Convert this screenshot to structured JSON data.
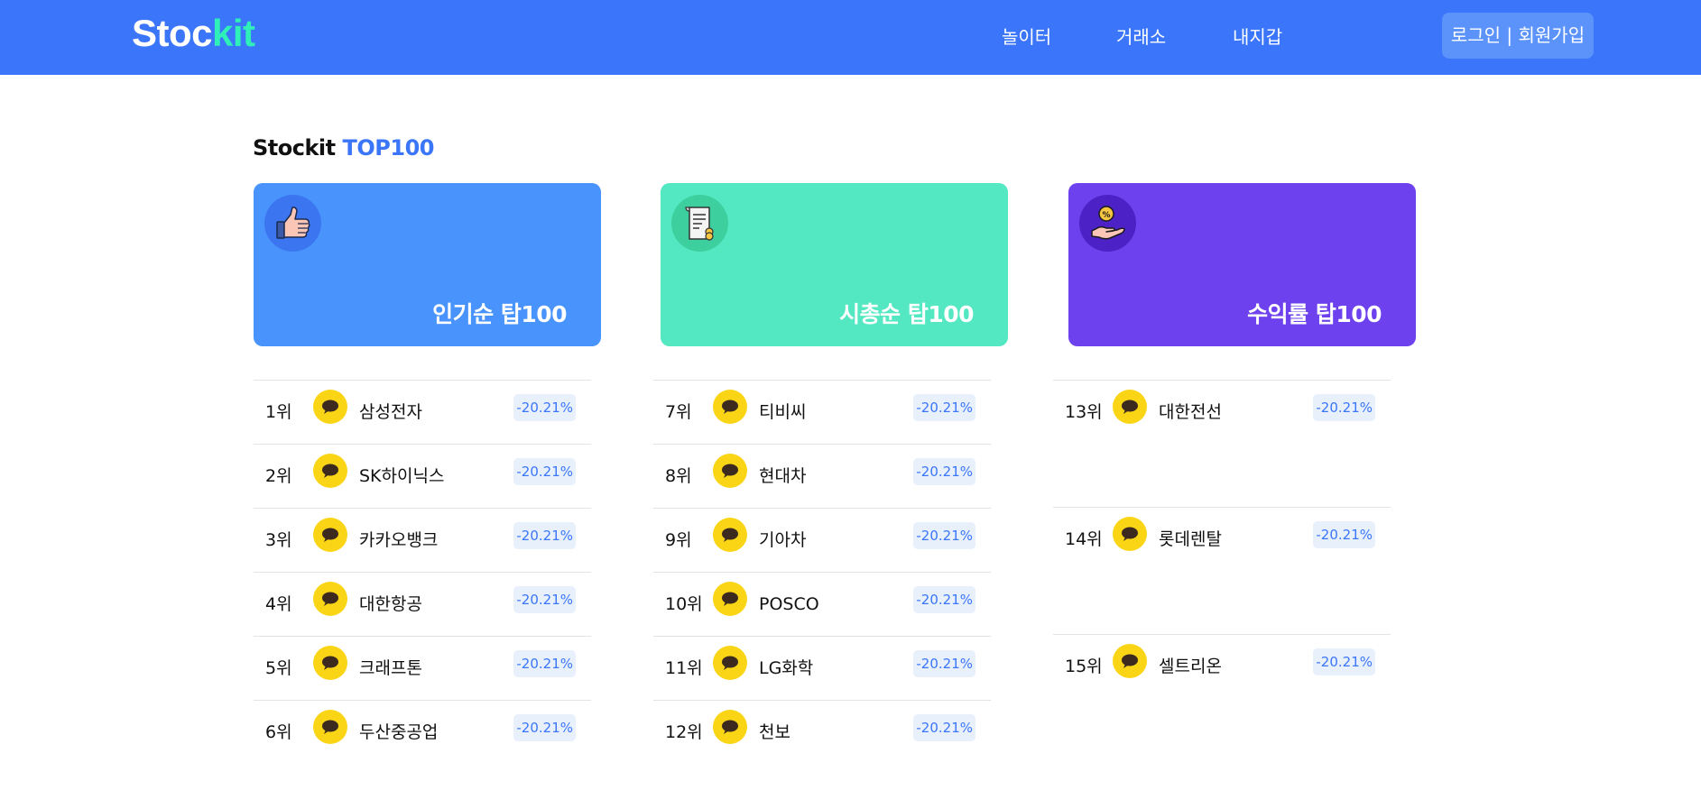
{
  "header": {
    "logo_part1": "Stoc",
    "logo_part2": "kit",
    "nav": [
      "놀이터",
      "거래소",
      "내지갑"
    ],
    "auth_label": "로그인 | 회원가입",
    "colors": {
      "bg": "#3b76fa",
      "logo_accent": "#2ff0b8"
    }
  },
  "section": {
    "title_part1": "Stockit",
    "title_part2": "TOP100"
  },
  "cards": [
    {
      "label": "인기순 탑100",
      "icon": "thumbs-up-icon",
      "color": "#4893fc",
      "icon_bg": "#3b76f0"
    },
    {
      "label": "시총순 탑100",
      "icon": "receipt-icon",
      "color": "#53e8c1",
      "icon_bg": "#3ecf9f"
    },
    {
      "label": "수익률 탑100",
      "icon": "coin-hand-icon",
      "color": "#6e41ee",
      "icon_bg": "#4c22c6"
    }
  ],
  "rankings": [
    [
      {
        "rank": "1위",
        "name": "삼성전자",
        "rate": "-20.21%",
        "icon": "chat-bubble-icon"
      },
      {
        "rank": "2위",
        "name": "SK하이닉스",
        "rate": "-20.21%",
        "icon": "chat-bubble-icon"
      },
      {
        "rank": "3위",
        "name": "카카오뱅크",
        "rate": "-20.21%",
        "icon": "chat-bubble-icon"
      },
      {
        "rank": "4위",
        "name": "대한항공",
        "rate": "-20.21%",
        "icon": "chat-bubble-icon"
      },
      {
        "rank": "5위",
        "name": "크래프톤",
        "rate": "-20.21%",
        "icon": "chat-bubble-icon"
      },
      {
        "rank": "6위",
        "name": "두산중공업",
        "rate": "-20.21%",
        "icon": "chat-bubble-icon"
      }
    ],
    [
      {
        "rank": "7위",
        "name": "티비씨",
        "rate": "-20.21%",
        "icon": "chat-bubble-icon"
      },
      {
        "rank": "8위",
        "name": "현대차",
        "rate": "-20.21%",
        "icon": "chat-bubble-icon"
      },
      {
        "rank": "9위",
        "name": "기아차",
        "rate": "-20.21%",
        "icon": "chat-bubble-icon"
      },
      {
        "rank": "10위",
        "name": "POSCO",
        "rate": "-20.21%",
        "icon": "chat-bubble-icon"
      },
      {
        "rank": "11위",
        "name": "LG화학",
        "rate": "-20.21%",
        "icon": "chat-bubble-icon"
      },
      {
        "rank": "12위",
        "name": "천보",
        "rate": "-20.21%",
        "icon": "chat-bubble-icon"
      }
    ],
    [
      {
        "rank": "13위",
        "name": "대한전선",
        "rate": "-20.21%",
        "icon": "chat-bubble-icon"
      },
      {
        "rank": "14위",
        "name": "롯데렌탈",
        "rate": "-20.21%",
        "icon": "chat-bubble-icon"
      },
      {
        "rank": "15위",
        "name": "셀트리온",
        "rate": "-20.21%",
        "icon": "chat-bubble-icon"
      }
    ]
  ]
}
